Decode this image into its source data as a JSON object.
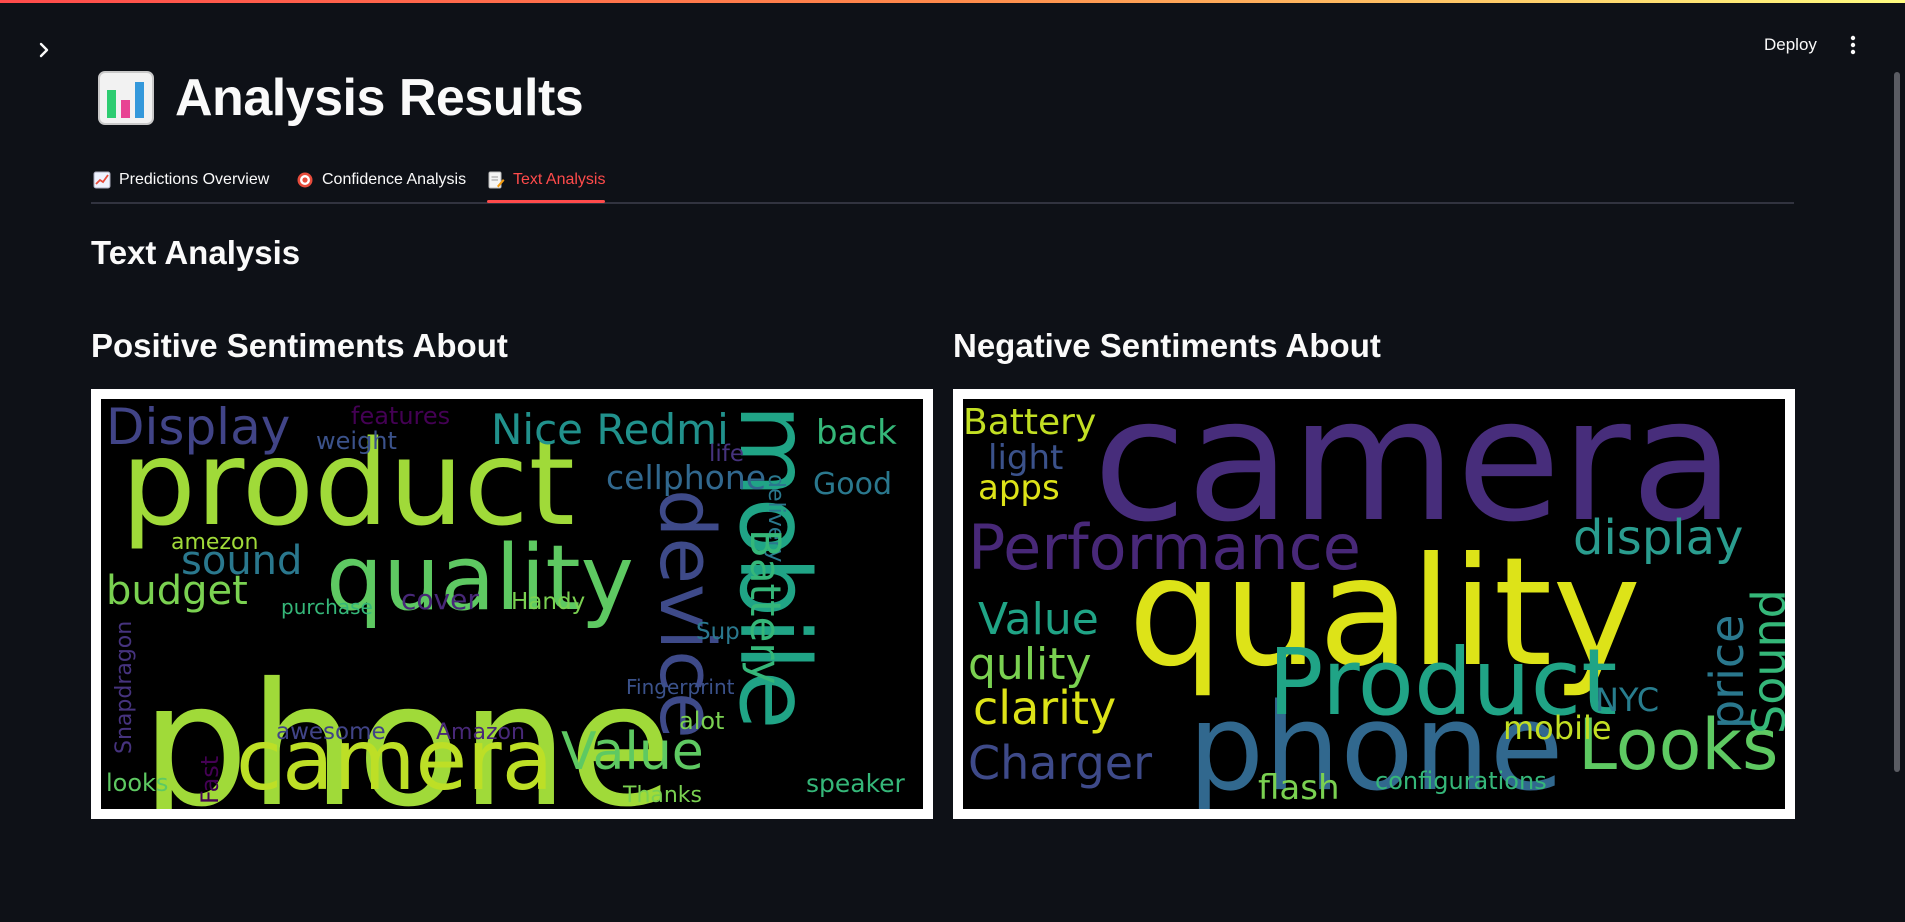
{
  "header": {
    "deploy_label": "Deploy"
  },
  "page": {
    "title": "Analysis Results"
  },
  "tabs": [
    {
      "label": "Predictions Overview",
      "active": false
    },
    {
      "label": "Confidence Analysis",
      "active": false
    },
    {
      "label": "Text Analysis",
      "active": true
    }
  ],
  "section": {
    "title": "Text Analysis"
  },
  "positive": {
    "title": "Positive Sentiments About",
    "words": [
      {
        "t": "phone",
        "c": "#a0da39",
        "s": 170,
        "r": 0
      },
      {
        "t": "product",
        "c": "#a0da39",
        "s": 118,
        "r": 0
      },
      {
        "t": "quality",
        "c": "#5ec962",
        "s": 90,
        "r": 0
      },
      {
        "t": "camera",
        "c": "#bddf26",
        "s": 84,
        "r": 0
      },
      {
        "t": "mobile",
        "c": "#20a486",
        "s": 96,
        "r": 90
      },
      {
        "t": "device",
        "c": "#3e4a89",
        "s": 76,
        "r": 90
      },
      {
        "t": "Display",
        "c": "#414487",
        "s": 50,
        "r": 0
      },
      {
        "t": "Nice Redmi",
        "c": "#21918c",
        "s": 42,
        "r": 0
      },
      {
        "t": "back",
        "c": "#35b779",
        "s": 34,
        "r": 0
      },
      {
        "t": "Good",
        "c": "#2a788e",
        "s": 30,
        "r": 0
      },
      {
        "t": "cellphone",
        "c": "#31688e",
        "s": 33,
        "r": 0
      },
      {
        "t": "features",
        "c": "#440154",
        "s": 24,
        "r": 0
      },
      {
        "t": "weight",
        "c": "#3b528b",
        "s": 24,
        "r": 0
      },
      {
        "t": "amezon",
        "c": "#a0da39",
        "s": 22,
        "r": 0
      },
      {
        "t": "sound",
        "c": "#2a788e",
        "s": 40,
        "r": 0
      },
      {
        "t": "budget",
        "c": "#7ad151",
        "s": 40,
        "r": 0
      },
      {
        "t": "purchase",
        "c": "#35b779",
        "s": 20,
        "r": 0
      },
      {
        "t": "cover",
        "c": "#482878",
        "s": 28,
        "r": 0
      },
      {
        "t": "Handy",
        "c": "#7ad151",
        "s": 23,
        "r": 0
      },
      {
        "t": "life",
        "c": "#46337e",
        "s": 23,
        "r": 0
      },
      {
        "t": "delivery",
        "c": "#2a788e",
        "s": 22,
        "r": 90
      },
      {
        "t": "Battery",
        "c": "#35b779",
        "s": 42,
        "r": 90
      },
      {
        "t": "Snapdragon",
        "c": "#46337e",
        "s": 22,
        "r": 270
      },
      {
        "t": "Fast",
        "c": "#440154",
        "s": 24,
        "r": 270
      },
      {
        "t": "Sup",
        "c": "#2a788e",
        "s": 23,
        "r": 0
      },
      {
        "t": "Fingerprint",
        "c": "#3b528b",
        "s": 20,
        "r": 0
      },
      {
        "t": "awesome",
        "c": "#414487",
        "s": 23,
        "r": 0
      },
      {
        "t": "Amazon",
        "c": "#482878",
        "s": 22,
        "r": 0
      },
      {
        "t": "alot",
        "c": "#7ad151",
        "s": 24,
        "r": 0
      },
      {
        "t": "Value",
        "c": "#5ec962",
        "s": 52,
        "r": 0
      },
      {
        "t": "looks",
        "c": "#5ec962",
        "s": 24,
        "r": 0
      },
      {
        "t": "Thanks",
        "c": "#7ad151",
        "s": 22,
        "r": 0
      },
      {
        "t": "speaker",
        "c": "#35b779",
        "s": 25,
        "r": 0
      }
    ]
  },
  "negative": {
    "title": "Negative Sentiments About",
    "words": [
      {
        "t": "camera",
        "c": "#472d7b",
        "s": 170,
        "r": 0
      },
      {
        "t": "quality",
        "c": "#dde318",
        "s": 150,
        "r": 0
      },
      {
        "t": "phone",
        "c": "#31688e",
        "s": 120,
        "r": 0
      },
      {
        "t": "Product",
        "c": "#20a486",
        "s": 92,
        "r": 0
      },
      {
        "t": "Performance",
        "c": "#482878",
        "s": 62,
        "r": 0
      },
      {
        "t": "Looks",
        "c": "#5ec962",
        "s": 70,
        "r": 0
      },
      {
        "t": "Battery",
        "c": "#c2df23",
        "s": 36,
        "r": 0
      },
      {
        "t": "light",
        "c": "#3b528b",
        "s": 34,
        "r": 0
      },
      {
        "t": "apps",
        "c": "#dde318",
        "s": 34,
        "r": 0
      },
      {
        "t": "display",
        "c": "#2a9d8f",
        "s": 48,
        "r": 0
      },
      {
        "t": "Value",
        "c": "#20a486",
        "s": 44,
        "r": 0
      },
      {
        "t": "qulity",
        "c": "#7ad151",
        "s": 44,
        "r": 0
      },
      {
        "t": "clarity",
        "c": "#dde318",
        "s": 46,
        "r": 0
      },
      {
        "t": "Charger",
        "c": "#3e4a89",
        "s": 46,
        "r": 0
      },
      {
        "t": "flash",
        "c": "#7ad151",
        "s": 34,
        "r": 0
      },
      {
        "t": "configurations",
        "c": "#35b779",
        "s": 24,
        "r": 0
      },
      {
        "t": "mobile",
        "c": "#c2df23",
        "s": 32,
        "r": 0
      },
      {
        "t": "NYC",
        "c": "#287d8e",
        "s": 32,
        "r": 0
      },
      {
        "t": "price",
        "c": "#2a788e",
        "s": 46,
        "r": 270
      },
      {
        "t": "Sound",
        "c": "#35b779",
        "s": 46,
        "r": 270
      }
    ]
  }
}
